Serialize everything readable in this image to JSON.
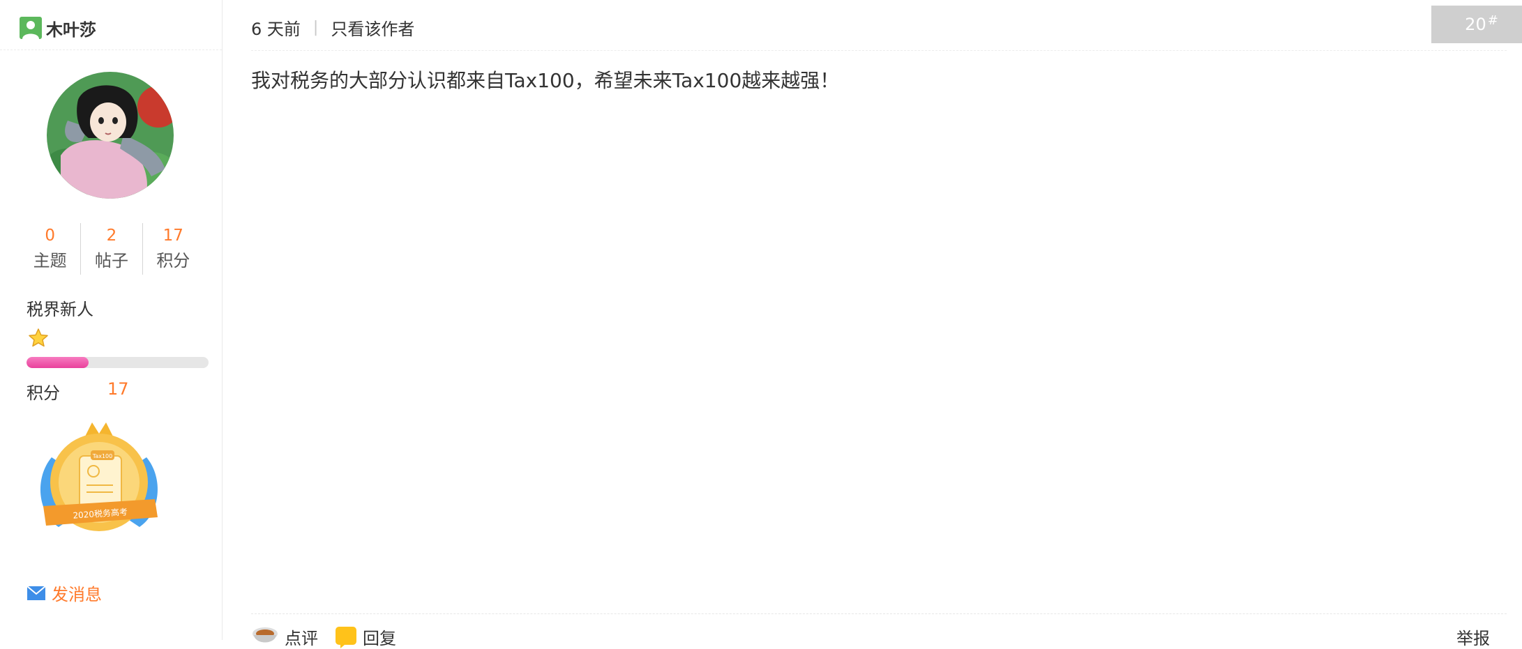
{
  "author": {
    "name": "木叶莎",
    "stats": [
      {
        "value": "0",
        "label": "主题"
      },
      {
        "value": "2",
        "label": "帖子"
      },
      {
        "value": "17",
        "label": "积分"
      }
    ],
    "rank_title": "税界新人",
    "progress_fraction": 0.34,
    "points_label": "积分",
    "points_value": "17",
    "medal_text": "2020税务高考",
    "medal_tag": "Tax100",
    "send_message": "发消息"
  },
  "post": {
    "time": "6 天前",
    "separator": "|",
    "author_only": "只看该作者",
    "floor_number": "20",
    "floor_suffix": "#",
    "content": "我对税务的大部分认识都来自Tax100，希望未来Tax100越来越强！"
  },
  "actions": {
    "comment": "点评",
    "reply": "回复",
    "report": "举报"
  },
  "colors": {
    "accent_orange": "#ff7a2b",
    "progress_pink": "#e9419c",
    "badge_gray": "#cfcfcf",
    "user_icon_green": "#5cb85c"
  }
}
